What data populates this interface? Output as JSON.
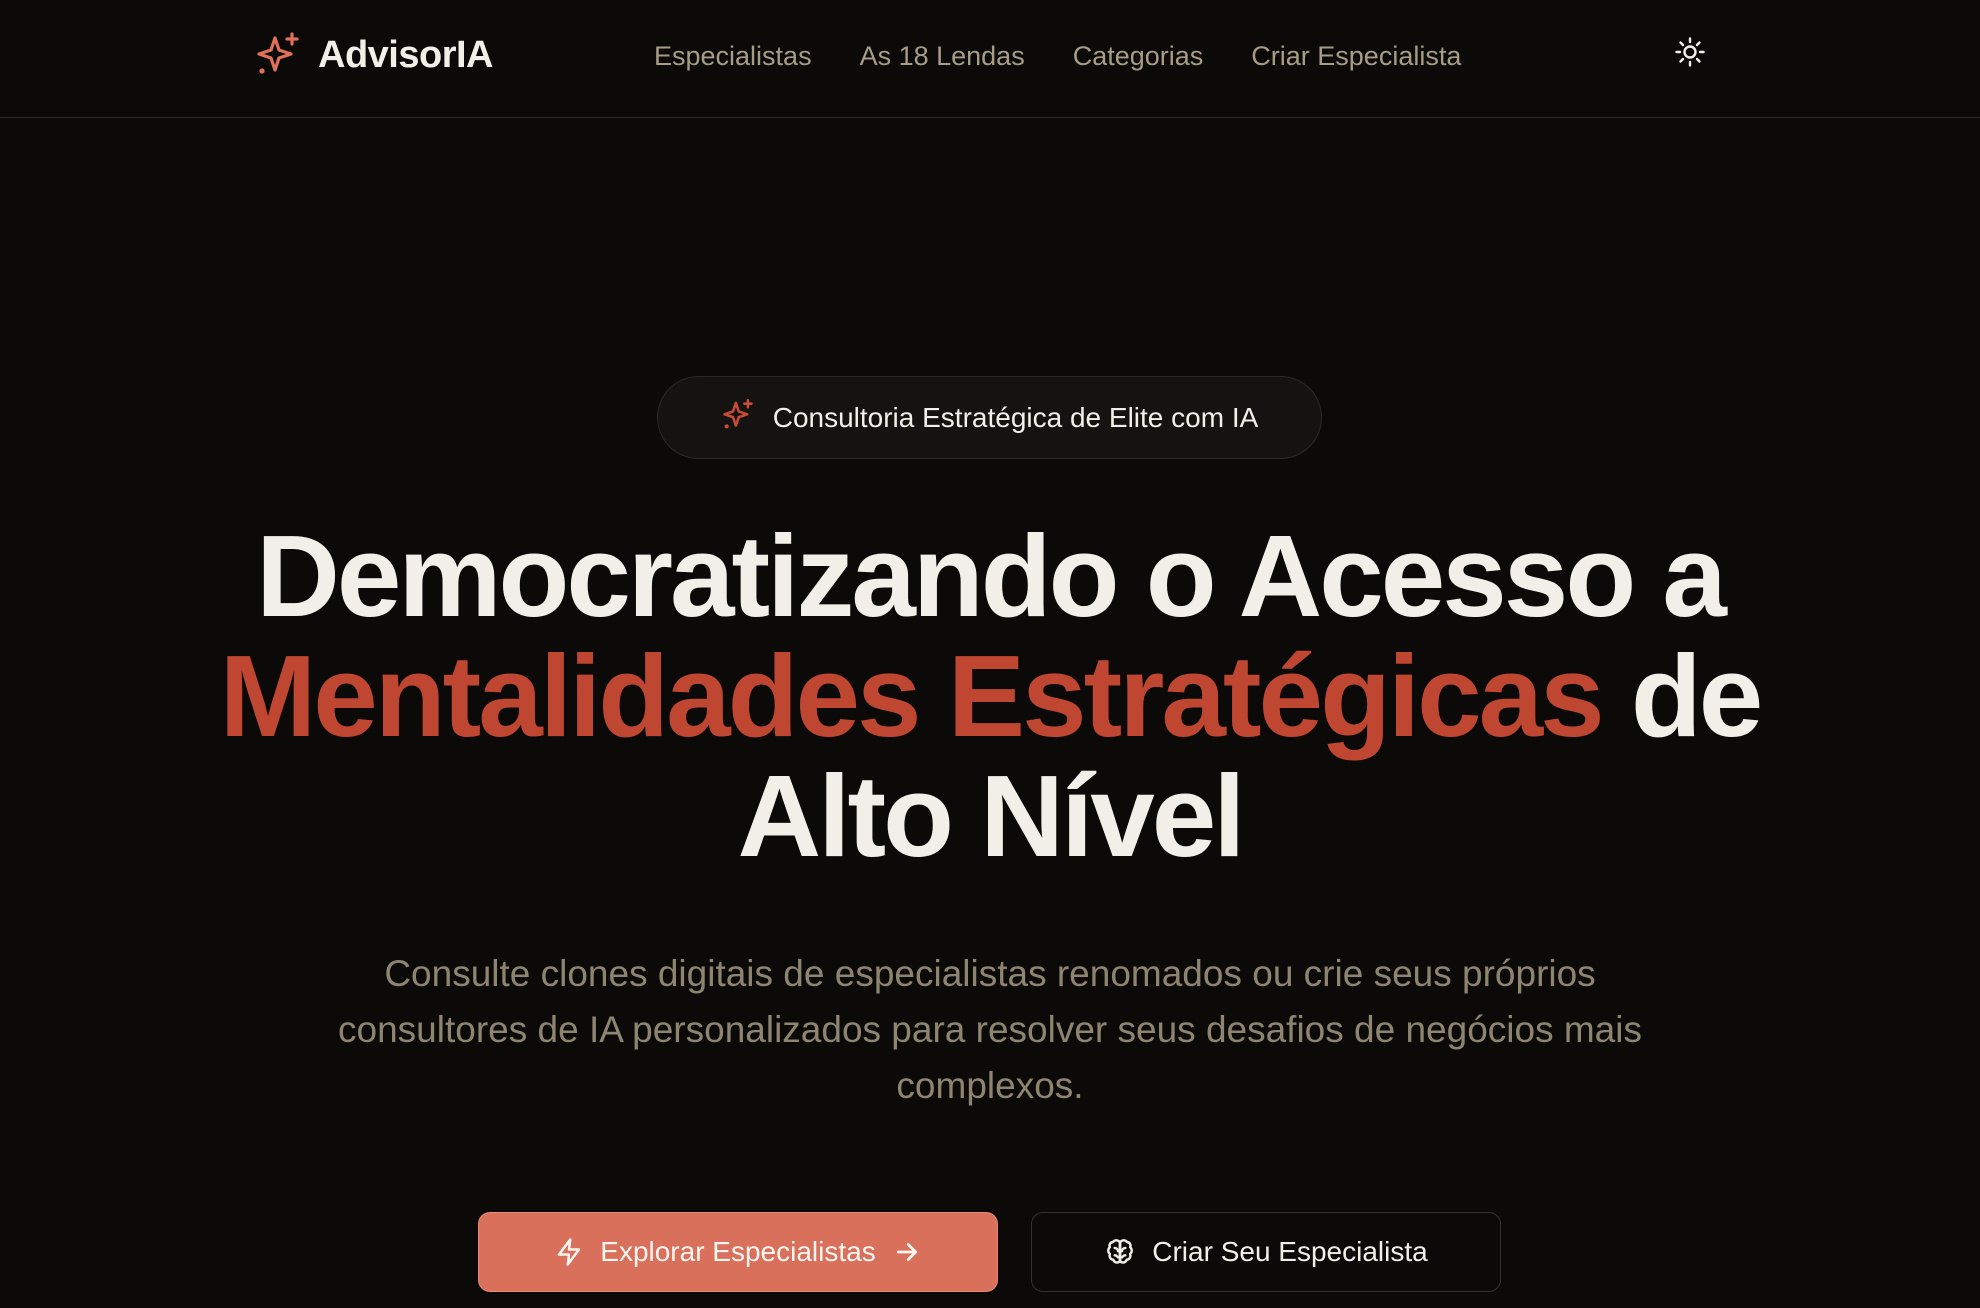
{
  "brand": {
    "name": "AdvisorIA",
    "icon": "sparkles-icon",
    "accent_color": "#bf4631",
    "button_color": "#d9705b"
  },
  "nav": {
    "items": [
      {
        "label": "Especialistas"
      },
      {
        "label": "As 18 Lendas"
      },
      {
        "label": "Categorias"
      },
      {
        "label": "Criar Especialista"
      }
    ],
    "theme_toggle_icon": "sun-icon"
  },
  "hero": {
    "badge": {
      "icon": "sparkles-icon",
      "text": "Consultoria Estratégica de Elite com IA"
    },
    "headline": {
      "part1": "Democratizando o Acesso a ",
      "highlight": "Mentalidades Estratégicas",
      "part2": " de Alto Nível"
    },
    "subtitle": "Consulte clones digitais de especialistas renomados ou crie seus próprios consultores de IA personalizados para resolver seus desafios de negócios mais complexos.",
    "primary_button": {
      "label": "Explorar Especialistas",
      "icon": "zap-icon",
      "trailing_icon": "arrow-right-icon"
    },
    "secondary_button": {
      "label": "Criar Seu Especialista",
      "icon": "brain-icon"
    }
  }
}
